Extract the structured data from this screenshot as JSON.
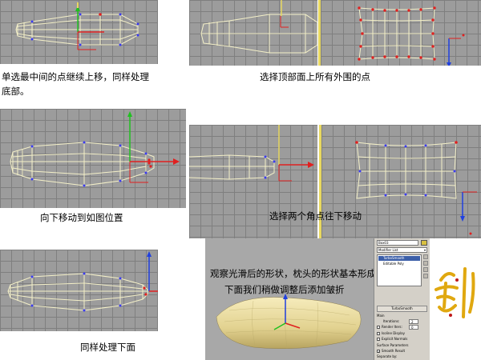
{
  "captions": {
    "panel1": "单选最中间的点继续上移，同样处理",
    "panel1_line2": "底部。",
    "panel2": "选择顶部面上所有外围的点",
    "panel3": "向下移动到如图位置",
    "panel4": "选择两个角点往下移动",
    "panel5": "同样处理下面",
    "panel6_line1": "观察光滑后的形状，枕头的形状基本形成",
    "panel6_line2": "下面我们稍做调整后添加皱折"
  },
  "command_panel": {
    "object_name": "Box03",
    "modifier_list_label": "Modifier List",
    "stack": [
      "TurboSmooth",
      "Editable Poly"
    ],
    "rollout_title": "TurboSmooth",
    "main_label": "Main",
    "iterations_label": "Iterations:",
    "iterations_value": "2",
    "render_iters_label": "Render Iters:",
    "render_iters_value": "0",
    "isoline_label": "Isoline Display",
    "explicit_normals_label": "Explicit Normals",
    "surface_params_label": "Surface Parameters",
    "smooth_result_label": "Smooth Result",
    "separate_label": "Separate by:"
  },
  "colors": {
    "viewport_bg": "#9c9c9c",
    "grid": "#7f7f7f",
    "wire": "#f4f0c8",
    "vertex": "#3a3af0",
    "selected_vertex": "#e02020",
    "gizmo_x": "#e02020",
    "gizmo_y": "#20c020",
    "gizmo_z": "#2040e0",
    "pillow": "#e8dca0"
  },
  "icons": {
    "logo": "sword-calligraphy-logo"
  }
}
